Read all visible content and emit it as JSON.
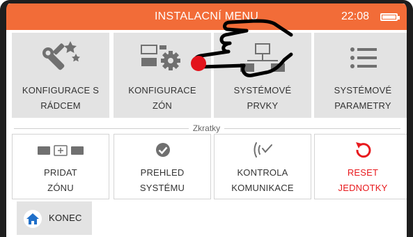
{
  "header": {
    "title": "INSTALACNÍ MENU",
    "clock": "22:08",
    "battery_icon": "battery-full-icon",
    "accent_color": "#f26c38"
  },
  "menu": {
    "items": [
      {
        "line1": "KONFIGURACE S",
        "line2": "RÁDCEM",
        "icon": "wizard-wrench-icon"
      },
      {
        "line1": "KONFIGURACE",
        "line2": "ZÓN",
        "icon": "zones-gear-icon"
      },
      {
        "line1": "SYSTÉMOVÉ",
        "line2": "PRVKY",
        "icon": "system-network-icon"
      },
      {
        "line1": "SYSTÉMOVÉ",
        "line2": "PARAMETRY",
        "icon": "list-icon"
      }
    ]
  },
  "shortcuts": {
    "title": "Zkratky",
    "items": [
      {
        "line1": "PRIDAT",
        "line2": "ZÓNU",
        "icon": "add-zone-icon"
      },
      {
        "line1": "PREHLED",
        "line2": "SYSTÉMU",
        "icon": "check-circle-icon"
      },
      {
        "line1": "KONTROLA",
        "line2": "KOMUNIKACE",
        "icon": "signal-check-icon"
      },
      {
        "line1": "RESET",
        "line2": "JEDNOTKY",
        "icon": "reset-icon",
        "color": "#e8191d"
      }
    ]
  },
  "footer": {
    "end_label": "KONEC",
    "end_icon": "home-icon",
    "home_color": "#1f6fc9"
  },
  "overlay": {
    "pointer_icon": "pointing-hand-icon",
    "touch_color": "#e3131c"
  }
}
